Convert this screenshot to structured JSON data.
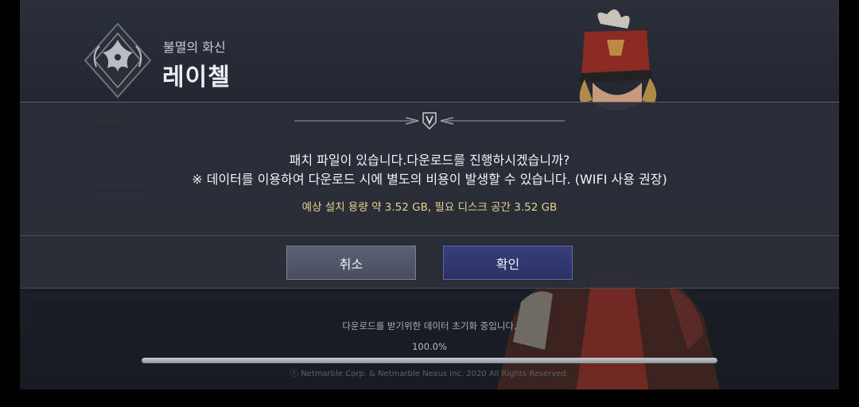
{
  "header": {
    "subtitle": "불멸의 화신",
    "title": "레이첼",
    "emblem_icon": "winged-crest-icon"
  },
  "dialog": {
    "message_line1": "패치 파일이 있습니다.다운로드를 진행하시겠습니까?",
    "message_line2": "※ 데이터를 이용하여 다운로드 시에 별도의 비용이 발생할 수 있습니다. (WIFI 사용 권장)",
    "size_info": "예상 설치 용량 약 3.52 GB, 필요 디스크 공간 3.52 GB",
    "cancel_label": "취소",
    "confirm_label": "확인",
    "ornament_icon": "shield-emblem-icon",
    "accent_color": "#e8d08f"
  },
  "footer": {
    "status": "다운로드를 받기위한 데이터 초기화 중입니다.",
    "percent": "100.0%",
    "progress": 1.0,
    "copyright": "ⓒ Netmarble Corp. & Netmarble Nexus Inc. 2020 All Rights Reserved."
  }
}
